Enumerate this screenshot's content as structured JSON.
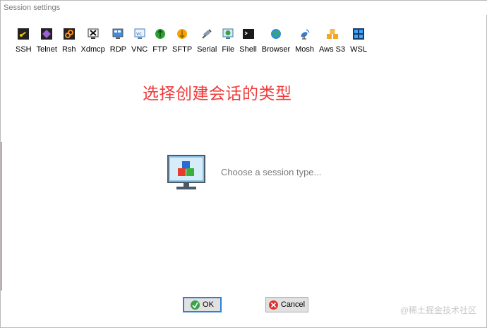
{
  "window": {
    "title": "Session settings"
  },
  "toolbar": {
    "items": [
      {
        "label": "SSH",
        "icon": "ssh-icon"
      },
      {
        "label": "Telnet",
        "icon": "telnet-icon"
      },
      {
        "label": "Rsh",
        "icon": "rsh-icon"
      },
      {
        "label": "Xdmcp",
        "icon": "xdmcp-icon"
      },
      {
        "label": "RDP",
        "icon": "rdp-icon"
      },
      {
        "label": "VNC",
        "icon": "vnc-icon"
      },
      {
        "label": "FTP",
        "icon": "ftp-icon"
      },
      {
        "label": "SFTP",
        "icon": "sftp-icon"
      },
      {
        "label": "Serial",
        "icon": "serial-icon"
      },
      {
        "label": "File",
        "icon": "file-icon"
      },
      {
        "label": "Shell",
        "icon": "shell-icon"
      },
      {
        "label": "Browser",
        "icon": "browser-icon"
      },
      {
        "label": "Mosh",
        "icon": "mosh-icon"
      },
      {
        "label": "Aws S3",
        "icon": "aws-s3-icon"
      },
      {
        "label": "WSL",
        "icon": "wsl-icon"
      }
    ]
  },
  "main": {
    "heading": "选择创建会话的类型",
    "placeholder": "Choose a session type..."
  },
  "buttons": {
    "ok_label": "OK",
    "cancel_label": "Cancel"
  },
  "watermark": "@稀土掘金技术社区",
  "colors": {
    "heading": "#f23a3a",
    "ok_border": "#2f7fd6"
  }
}
